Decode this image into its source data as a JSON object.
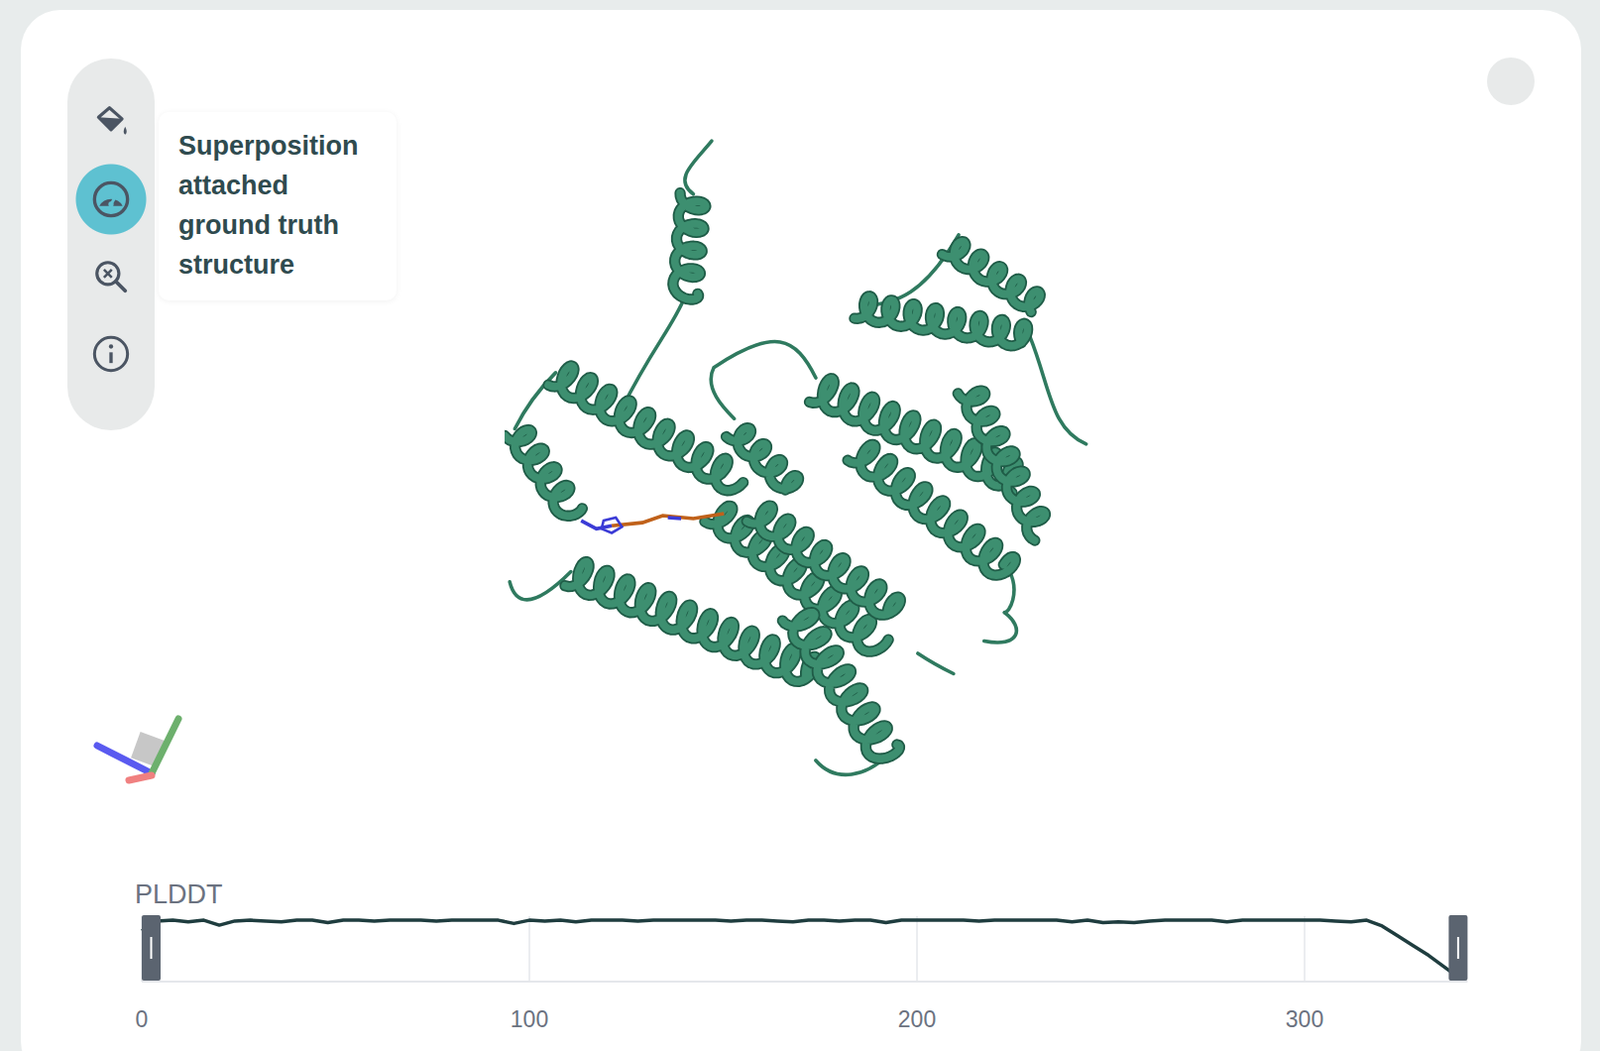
{
  "viewer": {
    "toolbar": [
      {
        "selected": false
      },
      {
        "selected": true
      },
      {
        "selected": false
      },
      {
        "selected": false
      }
    ],
    "tooltip": "Superposition attached ground truth structure"
  },
  "chart": {
    "label": "PLDDT",
    "ticks": [
      "0",
      "100",
      "200",
      "300"
    ],
    "values": [
      82,
      94,
      95,
      93,
      95,
      89,
      94,
      95,
      94,
      93,
      95,
      95,
      92,
      95,
      95,
      94,
      95,
      95,
      95,
      94,
      95,
      95,
      95,
      95,
      91,
      95,
      94,
      95,
      93,
      95,
      95,
      95,
      94,
      95,
      95,
      95,
      95,
      95,
      94,
      95,
      95,
      94,
      93,
      95,
      95,
      94,
      95,
      95,
      92,
      95,
      95,
      95,
      95,
      95,
      94,
      95,
      95,
      95,
      95,
      95,
      93,
      95,
      92,
      93,
      92,
      94,
      95,
      95,
      95,
      95,
      93,
      95,
      95,
      95,
      95,
      95,
      95,
      94,
      93,
      95,
      88,
      76,
      64,
      52,
      38,
      24
    ]
  }
}
